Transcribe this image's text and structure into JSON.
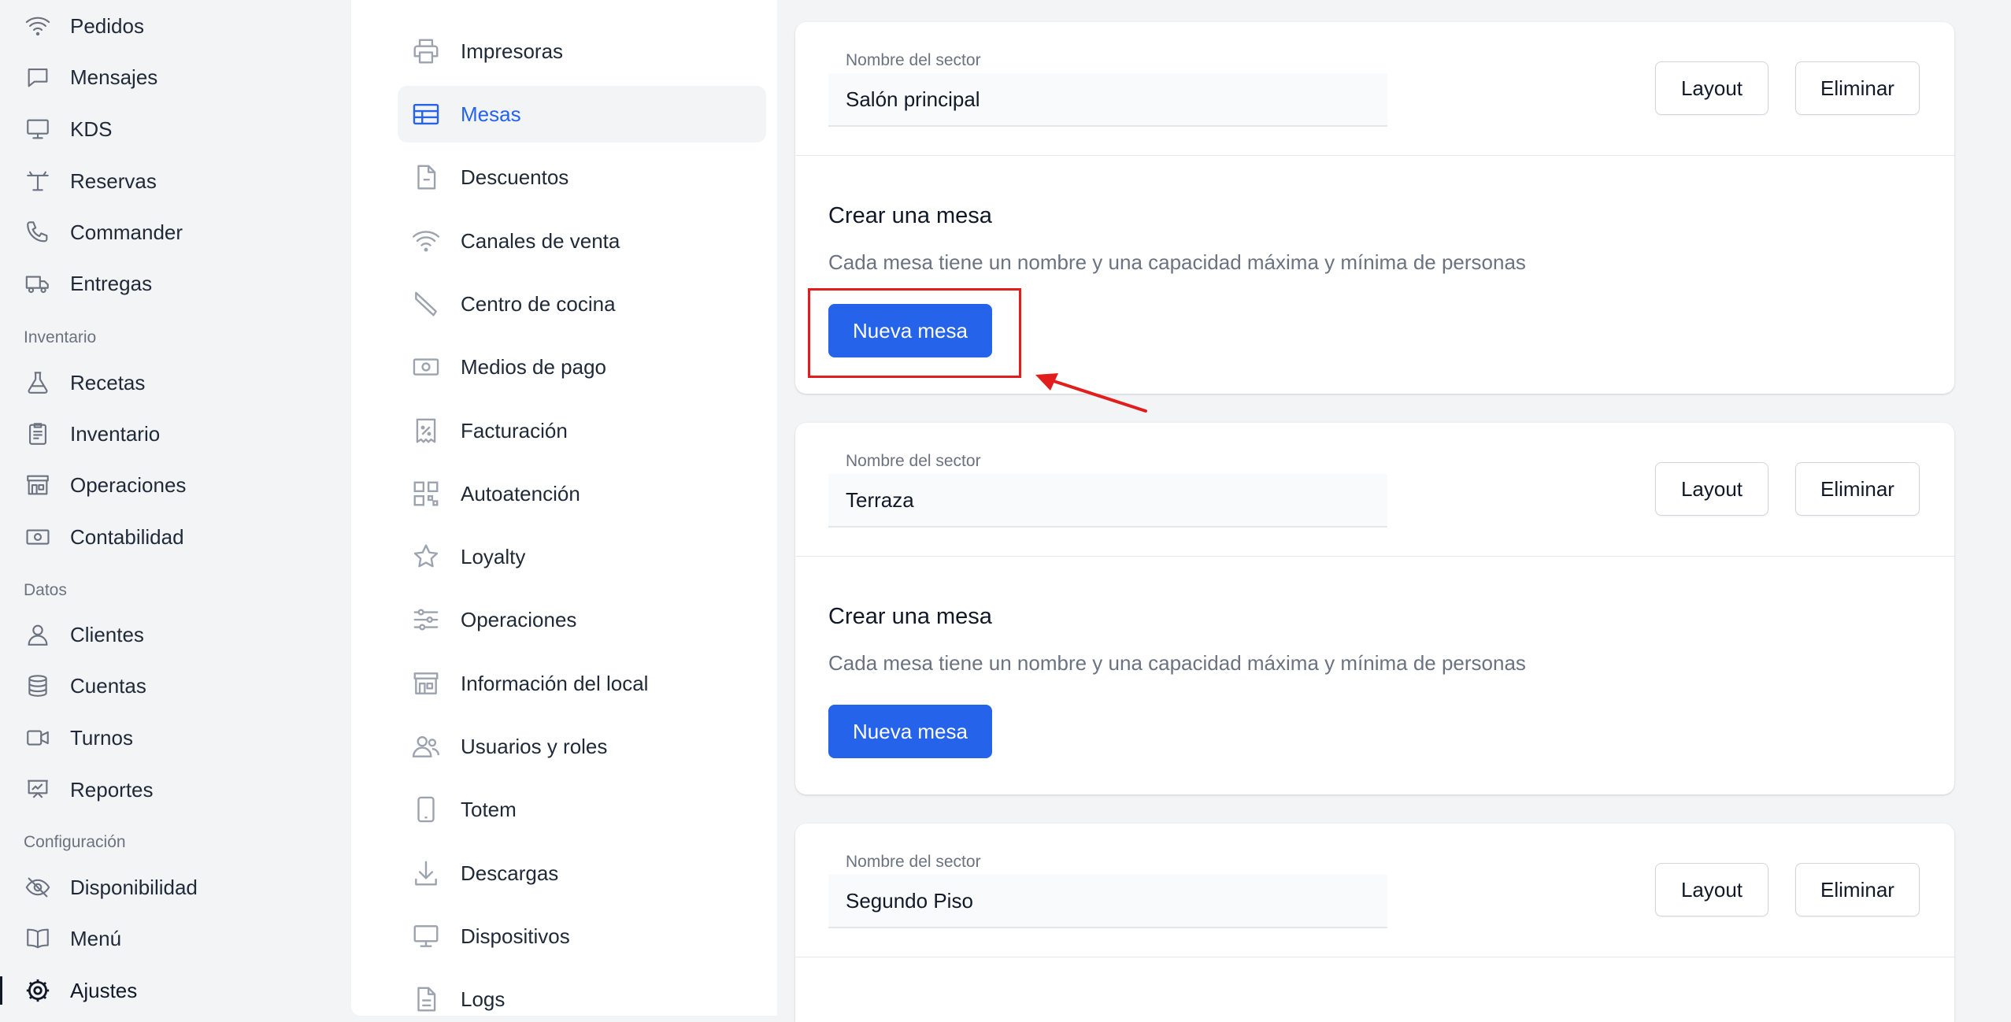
{
  "sidebar": {
    "items_top": [
      {
        "label": "Pedidos",
        "icon": "wifi-icon"
      },
      {
        "label": "Mensajes",
        "icon": "chat-bubble-icon"
      },
      {
        "label": "KDS",
        "icon": "monitor-icon"
      },
      {
        "label": "Reservas",
        "icon": "table-reserve-icon"
      },
      {
        "label": "Commander",
        "icon": "phone-icon"
      },
      {
        "label": "Entregas",
        "icon": "truck-icon"
      }
    ],
    "section_inventario": "Inventario",
    "items_inventario": [
      {
        "label": "Recetas",
        "icon": "flask-icon"
      },
      {
        "label": "Inventario",
        "icon": "clipboard-icon"
      },
      {
        "label": "Operaciones",
        "icon": "storefront-icon"
      },
      {
        "label": "Contabilidad",
        "icon": "cash-icon"
      }
    ],
    "section_datos": "Datos",
    "items_datos": [
      {
        "label": "Clientes",
        "icon": "user-icon"
      },
      {
        "label": "Cuentas",
        "icon": "database-icon"
      },
      {
        "label": "Turnos",
        "icon": "video-camera-icon"
      },
      {
        "label": "Reportes",
        "icon": "presentation-chart-icon"
      }
    ],
    "section_config": "Configuración",
    "items_config": [
      {
        "label": "Disponibilidad",
        "icon": "eye-slash-icon"
      },
      {
        "label": "Menú",
        "icon": "book-open-icon"
      },
      {
        "label": "Ajustes",
        "icon": "cog-icon"
      }
    ]
  },
  "settings_nav": [
    {
      "label": "Impresoras",
      "icon": "printer-icon"
    },
    {
      "label": "Mesas",
      "icon": "table-icon"
    },
    {
      "label": "Descuentos",
      "icon": "document-icon"
    },
    {
      "label": "Canales de venta",
      "icon": "wifi-icon"
    },
    {
      "label": "Centro de cocina",
      "icon": "knife-icon"
    },
    {
      "label": "Medios de pago",
      "icon": "cash-icon"
    },
    {
      "label": "Facturación",
      "icon": "receipt-percent-icon"
    },
    {
      "label": "Autoatención",
      "icon": "qr-code-icon"
    },
    {
      "label": "Loyalty",
      "icon": "star-icon"
    },
    {
      "label": "Operaciones",
      "icon": "adjustments-icon"
    },
    {
      "label": "Información del local",
      "icon": "storefront-icon"
    },
    {
      "label": "Usuarios y roles",
      "icon": "users-icon"
    },
    {
      "label": "Totem",
      "icon": "tablet-icon"
    },
    {
      "label": "Descargas",
      "icon": "download-icon"
    },
    {
      "label": "Dispositivos",
      "icon": "computer-icon"
    },
    {
      "label": "Logs",
      "icon": "document-text-icon"
    }
  ],
  "sectors": [
    {
      "field_label": "Nombre del sector",
      "name": "Salón principal",
      "layout_label": "Layout",
      "delete_label": "Eliminar",
      "create_title": "Crear una mesa",
      "create_desc": "Cada mesa tiene un nombre y una capacidad máxima y mínima de personas",
      "new_table_label": "Nueva mesa"
    },
    {
      "field_label": "Nombre del sector",
      "name": "Terraza",
      "layout_label": "Layout",
      "delete_label": "Eliminar",
      "create_title": "Crear una mesa",
      "create_desc": "Cada mesa tiene un nombre y una capacidad máxima y mínima de personas",
      "new_table_label": "Nueva mesa"
    },
    {
      "field_label": "Nombre del sector",
      "name": "Segundo Piso",
      "layout_label": "Layout",
      "delete_label": "Eliminar"
    }
  ],
  "colors": {
    "primary": "#2563eb",
    "annotation": "#e11d1d",
    "background": "#f3f4f6"
  }
}
